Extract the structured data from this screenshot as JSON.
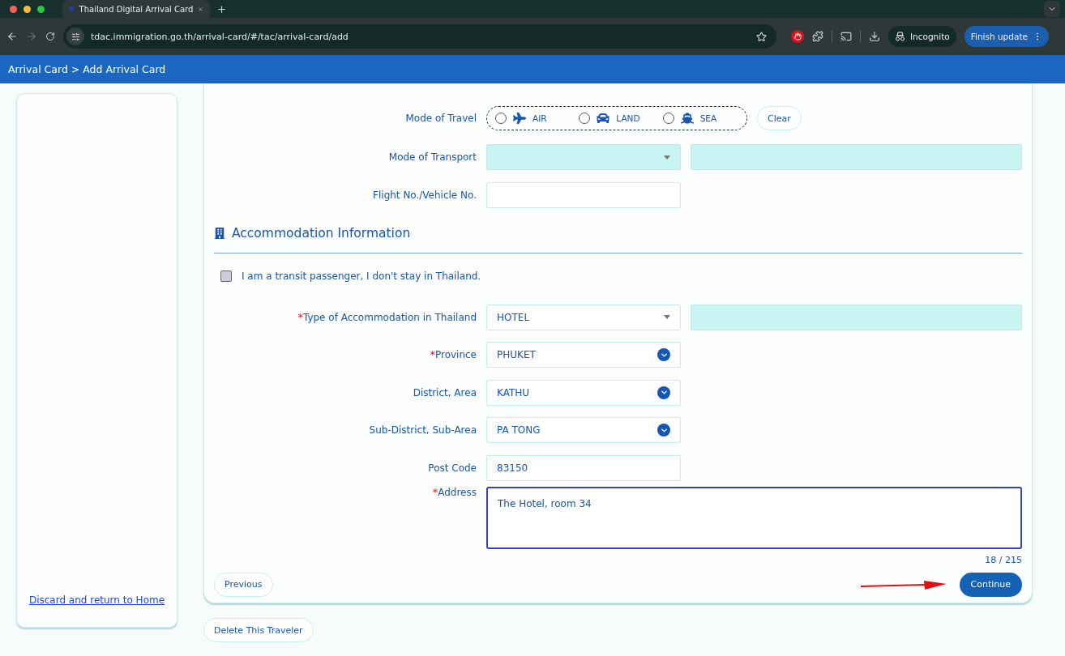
{
  "browser": {
    "tab": {
      "title": "Thailand Digital Arrival Card",
      "selected": true
    },
    "url": "tdac.immigration.go.th/arrival-card/#/tac/arrival-card/add",
    "incognito": "Incognito",
    "update_button": "Finish update"
  },
  "header": {
    "breadcrumb": "Arrival Card > Add Arrival Card"
  },
  "sidebar": {
    "link": "Discard and return to Home"
  },
  "required_mark": "*",
  "travel": {
    "label": "Mode of Travel",
    "options": [
      {
        "label": "AIR",
        "kind": "air",
        "selected": false
      },
      {
        "label": "LAND",
        "kind": "land",
        "selected": false
      },
      {
        "label": "SEA",
        "kind": "sea",
        "selected": false
      }
    ],
    "clear_button": "Clear"
  },
  "transport_fields": [
    {
      "kind": "select",
      "label": "Mode of Transport",
      "required": false,
      "disabled": true,
      "extra_field": true
    },
    {
      "kind": "text",
      "label": "Flight No./Vehicle No.",
      "required": false,
      "disabled": false,
      "extra_field": false
    }
  ],
  "accommodation": {
    "title": "Accommodation Information",
    "transit": {
      "label": "I am a transit passenger, I don't stay in Thailand.",
      "checked": false
    },
    "fields": [
      {
        "kind": "select",
        "label": "Type of Accommodation in Thailand",
        "required": true,
        "value": "HOTEL",
        "disabled": false,
        "extra_field": true
      },
      {
        "kind": "dropdown",
        "label": "Province",
        "required": true,
        "value": "PHUKET",
        "disabled": false,
        "extra_field": false
      },
      {
        "kind": "dropdown",
        "label": "District, Area",
        "required": false,
        "value": "KATHU",
        "disabled": false,
        "extra_field": false
      },
      {
        "kind": "dropdown",
        "label": "Sub-District, Sub-Area",
        "required": false,
        "value": "PA TONG",
        "disabled": false,
        "extra_field": false
      },
      {
        "kind": "text",
        "label": "Post Code",
        "required": false,
        "value": "83150",
        "disabled": false,
        "extra_field": false
      },
      {
        "kind": "textarea",
        "label": "Address",
        "required": true,
        "value": "The Hotel, room 34",
        "disabled": false,
        "counter": "18 / 215"
      }
    ]
  },
  "buttons": {
    "previous": "Previous",
    "continue": "Continue",
    "delete": "Delete This Traveler"
  }
}
